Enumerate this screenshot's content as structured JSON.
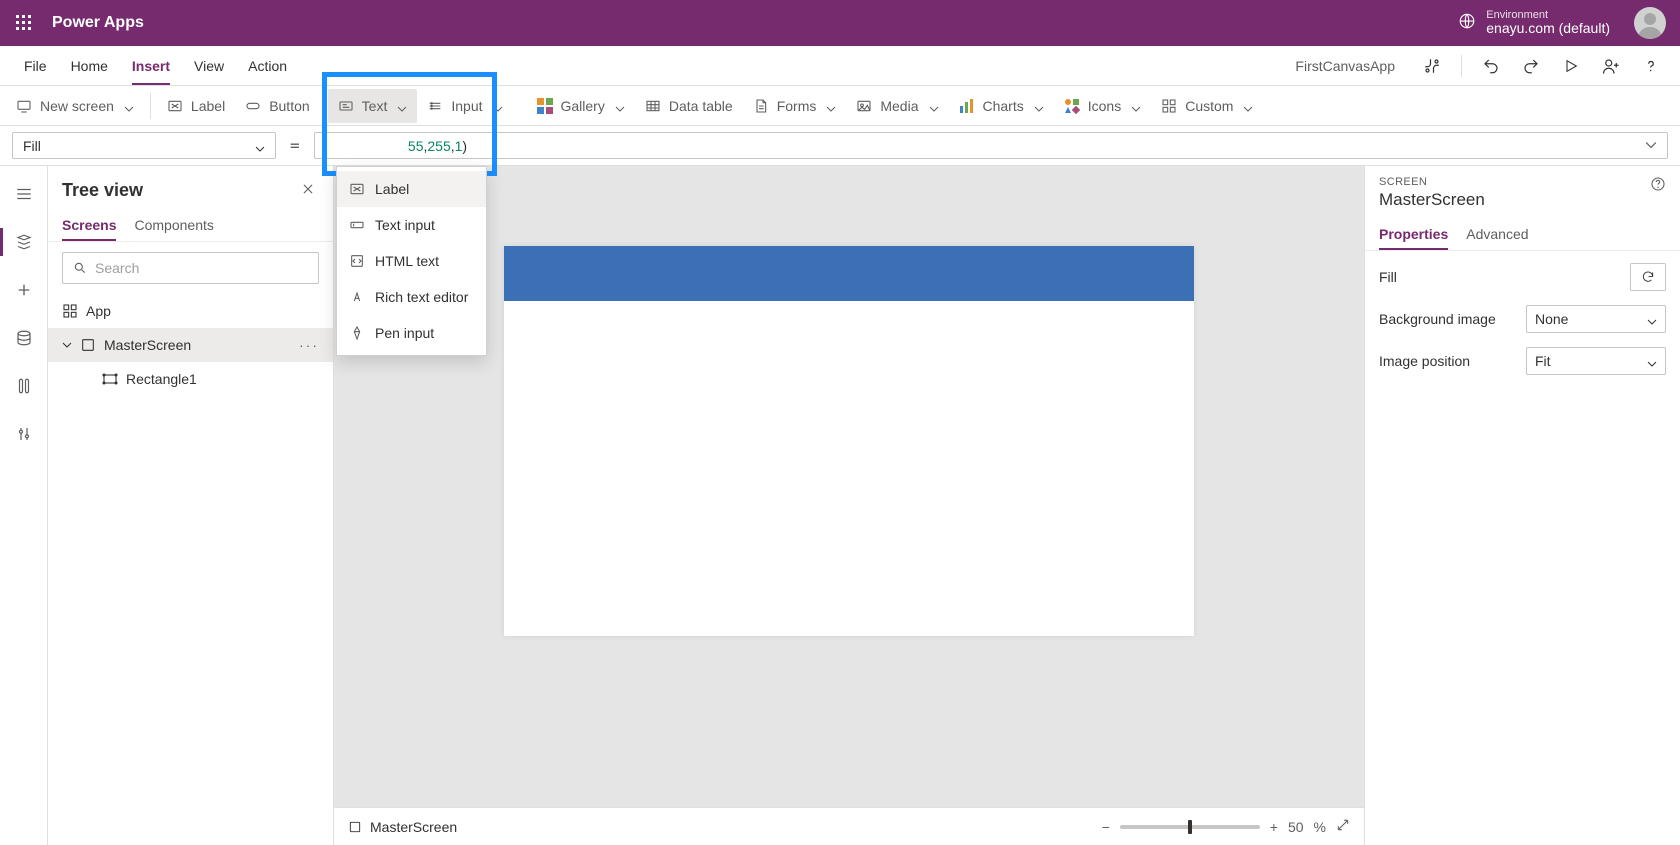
{
  "header": {
    "app_title": "Power Apps",
    "environment_label": "Environment",
    "environment_name": "enayu.com (default)"
  },
  "menu": {
    "items": [
      "File",
      "Home",
      "Insert",
      "View",
      "Action"
    ],
    "active": "Insert",
    "app_name": "FirstCanvasApp"
  },
  "toolbar": {
    "new_screen": "New screen",
    "label": "Label",
    "button": "Button",
    "text": "Text",
    "input": "Input",
    "gallery": "Gallery",
    "data_table": "Data table",
    "forms": "Forms",
    "media": "Media",
    "charts": "Charts",
    "icons": "Icons",
    "custom": "Custom"
  },
  "text_dropdown": {
    "items": [
      {
        "id": "label",
        "label": "Label"
      },
      {
        "id": "text-input",
        "label": "Text input"
      },
      {
        "id": "html-text",
        "label": "HTML text"
      },
      {
        "id": "rich-text-editor",
        "label": "Rich text editor"
      },
      {
        "id": "pen-input",
        "label": "Pen input"
      }
    ],
    "hovered": "label"
  },
  "formula": {
    "property": "Fill",
    "partial_code": "55, 255, 1)"
  },
  "tree": {
    "title": "Tree view",
    "tabs": {
      "screens": "Screens",
      "components": "Components"
    },
    "search_placeholder": "Search",
    "app": "App",
    "screen": "MasterScreen",
    "child": "Rectangle1"
  },
  "canvas": {
    "footer_screen": "MasterScreen",
    "zoom_percent": "50",
    "zoom_suffix": "%"
  },
  "props": {
    "kind": "SCREEN",
    "name": "MasterScreen",
    "tabs": {
      "properties": "Properties",
      "advanced": "Advanced"
    },
    "fill_label": "Fill",
    "bg_label": "Background image",
    "bg_value": "None",
    "pos_label": "Image position",
    "pos_value": "Fit"
  }
}
